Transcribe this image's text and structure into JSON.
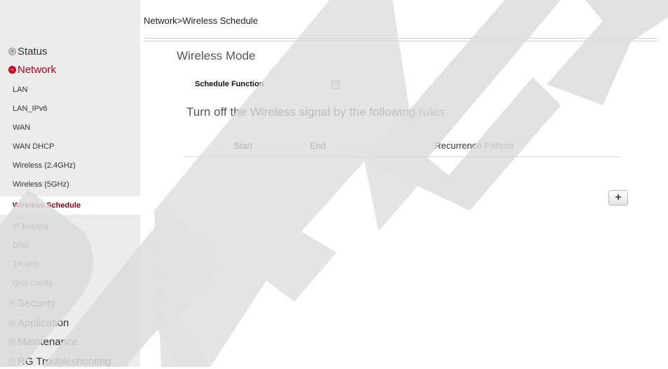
{
  "breadcrumb": "Network>Wireless Schedule",
  "sidebar": {
    "sections_top": [
      {
        "label": "Status",
        "icon": "plus-circle-icon",
        "active": false
      },
      {
        "label": "Network",
        "icon": "minus-circle-icon",
        "active": true
      }
    ],
    "items": [
      {
        "label": "LAN"
      },
      {
        "label": "LAN_IPv6"
      },
      {
        "label": "WAN"
      },
      {
        "label": "WAN DHCP"
      },
      {
        "label": "Wireless (2.4GHz)"
      },
      {
        "label": "Wireless (5GHz)"
      },
      {
        "label": "Wireless Schedule",
        "selected": true
      },
      {
        "label": "IP Routing"
      },
      {
        "label": "DNS"
      },
      {
        "label": "TR-069"
      },
      {
        "label": "QoS Config"
      }
    ],
    "sections_bottom": [
      {
        "label": "Security",
        "icon": "plus-circle-icon"
      },
      {
        "label": "Application",
        "icon": "plus-circle-icon"
      },
      {
        "label": "Maintenance",
        "icon": "plus-circle-icon"
      },
      {
        "label": "RG Troubleshooting",
        "icon": "plus-circle-icon"
      }
    ]
  },
  "main": {
    "section_title": "Wireless Mode",
    "schedule_function_label": "Schedule Function",
    "schedule_function_checked": false,
    "rules_heading": "Turn off the Wireless signal by the following rules",
    "columns": [
      "Start",
      "End",
      "Recurrence Pattern"
    ],
    "rows": [],
    "add_button_label": "+"
  },
  "watermark": "DRAFT",
  "colors": {
    "active_section": "#b3001b",
    "selected_item": "#8b0010",
    "sidebar_bg": "#ececec",
    "watermark": "#d9d9d9"
  }
}
